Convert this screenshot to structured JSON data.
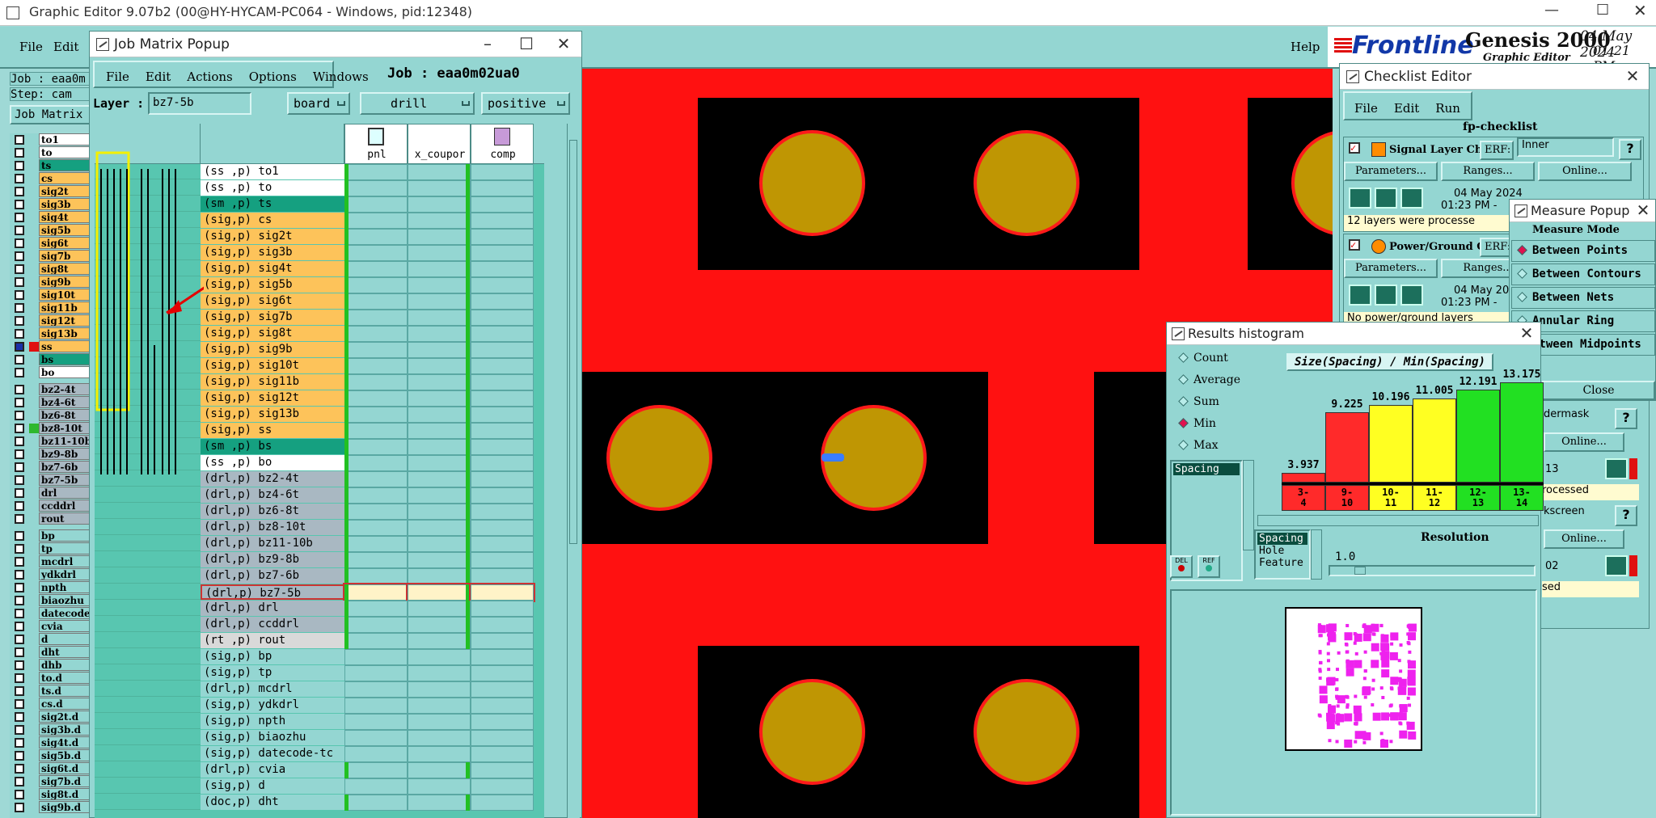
{
  "app": {
    "title": "Graphic Editor 9.07b2 (00@HY-HYCAM-PC064 - Windows, pid:12348)",
    "menu": [
      "File",
      "Edit"
    ],
    "help": "Help",
    "job_label": "Job : eaa0m",
    "step_label": "Step: cam",
    "job_matrix_btn": "Job Matrix"
  },
  "brand": {
    "logo": "Frontline",
    "product": "Genesis 2000",
    "subtitle": "Graphic Editor",
    "date": "04 May 2024",
    "time": "01:21 PM"
  },
  "left_layers": [
    "to1",
    "to",
    "ts",
    "cs",
    "sig2t",
    "sig3b",
    "sig4t",
    "sig5b",
    "sig6t",
    "sig7b",
    "sig8t",
    "sig9b",
    "sig10t",
    "sig11b",
    "sig12t",
    "sig13b",
    "ss",
    "bs",
    "bo",
    "bz2-4t",
    "bz4-6t",
    "bz6-8t",
    "bz8-10t",
    "bz11-10b",
    "bz9-8b",
    "bz7-6b",
    "bz7-5b",
    "drl",
    "ccddrl",
    "rout",
    "bp",
    "tp",
    "mcdrl",
    "ydkdrl",
    "npth",
    "biaozhu",
    "datecode",
    "cvia",
    "d",
    "dht",
    "dhb",
    "to.d",
    "ts.d",
    "cs.d",
    "sig2t.d",
    "sig3b.d",
    "sig4t.d",
    "sig5b.d",
    "sig6t.d",
    "sig7b.d",
    "sig8t.d",
    "sig9b.d"
  ],
  "job_matrix": {
    "title": "Job Matrix Popup",
    "menu": [
      "File",
      "Edit",
      "Actions",
      "Options",
      "Windows"
    ],
    "job": "Job : eaa0m02ua0",
    "layer_label": "Layer :",
    "layer_value": "bz7-5b",
    "ctx": "board",
    "type": "drill",
    "polarity": "positive",
    "steps": [
      "pnl",
      "x_coupor",
      "comp"
    ],
    "rows": [
      {
        "n": "(ss ,p) to1",
        "c": "#ffffff"
      },
      {
        "n": "(ss ,p) to",
        "c": "#ffffff"
      },
      {
        "n": "(sm ,p) ts",
        "c": "#15a080"
      },
      {
        "n": "(sig,p) cs",
        "c": "#fdc35a"
      },
      {
        "n": "(sig,p) sig2t",
        "c": "#fdc35a"
      },
      {
        "n": "(sig,p) sig3b",
        "c": "#fdc35a"
      },
      {
        "n": "(sig,p) sig4t",
        "c": "#fdc35a"
      },
      {
        "n": "(sig,p) sig5b",
        "c": "#fdc35a"
      },
      {
        "n": "(sig,p) sig6t",
        "c": "#fdc35a"
      },
      {
        "n": "(sig,p) sig7b",
        "c": "#fdc35a"
      },
      {
        "n": "(sig,p) sig8t",
        "c": "#fdc35a"
      },
      {
        "n": "(sig,p) sig9b",
        "c": "#fdc35a"
      },
      {
        "n": "(sig,p) sig10t",
        "c": "#fdc35a"
      },
      {
        "n": "(sig,p) sig11b",
        "c": "#fdc35a"
      },
      {
        "n": "(sig,p) sig12t",
        "c": "#fdc35a"
      },
      {
        "n": "(sig,p) sig13b",
        "c": "#fdc35a"
      },
      {
        "n": "(sig,p) ss",
        "c": "#fdc35a"
      },
      {
        "n": "(sm ,p) bs",
        "c": "#15a080"
      },
      {
        "n": "(ss ,p) bo",
        "c": "#ffffff"
      },
      {
        "n": "(drl,p) bz2-4t",
        "c": "#a9b8c2"
      },
      {
        "n": "(drl,p) bz4-6t",
        "c": "#a9b8c2"
      },
      {
        "n": "(drl,p) bz6-8t",
        "c": "#a9b8c2"
      },
      {
        "n": "(drl,p) bz8-10t",
        "c": "#a9b8c2"
      },
      {
        "n": "(drl,p) bz11-10b",
        "c": "#a9b8c2"
      },
      {
        "n": "(drl,p) bz9-8b",
        "c": "#a9b8c2"
      },
      {
        "n": "(drl,p) bz7-6b",
        "c": "#a9b8c2"
      },
      {
        "n": "(drl,p) bz7-5b",
        "c": "#a9b8c2"
      },
      {
        "n": "(drl,p) drl",
        "c": "#a9b8c2"
      },
      {
        "n": "(drl,p) ccddrl",
        "c": "#a9b8c2"
      },
      {
        "n": "(rt ,p) rout",
        "c": "#d9d9d9"
      },
      {
        "n": "(sig,p) bp",
        "c": "#94d6d2"
      },
      {
        "n": "(sig,p) tp",
        "c": "#94d6d2"
      },
      {
        "n": "(drl,p) mcdrl",
        "c": "#94d6d2"
      },
      {
        "n": "(sig,p) ydkdrl",
        "c": "#94d6d2"
      },
      {
        "n": "(sig,p) npth",
        "c": "#94d6d2"
      },
      {
        "n": "(sig,p) biaozhu",
        "c": "#94d6d2"
      },
      {
        "n": "(sig,p) datecode-tc",
        "c": "#94d6d2"
      },
      {
        "n": "(drl,p) cvia",
        "c": "#94d6d2"
      },
      {
        "n": "(sig,p) d",
        "c": "#94d6d2"
      },
      {
        "n": "(doc,p) dht",
        "c": "#94d6d2"
      }
    ]
  },
  "checklist": {
    "title": "Checklist Editor",
    "menu": [
      "File",
      "Edit",
      "Run"
    ],
    "name": "fp-checklist",
    "action1": "Signal Layer Ch",
    "erf": "ERF:",
    "erf_val1": "Inner",
    "params": "Parameters...",
    "ranges": "Ranges...",
    "online": "Online...",
    "date": "04 May 2024",
    "time": "01:23 PM -",
    "status1": "12 layers were processe",
    "action2": "Power/Ground C",
    "status2": "No power/ground layers",
    "frag1": "dermask",
    "frag2": "13",
    "frag3": "rocessed",
    "frag4": "kscreen",
    "frag5": "02",
    "frag6": "sed",
    "help": "?"
  },
  "measure": {
    "title": "Measure Popup",
    "mode": "Measure Mode",
    "options": [
      "Between Points",
      "Between Contours",
      "Between Nets",
      "Annular Ring",
      "etween Midpoints"
    ],
    "close": "Close"
  },
  "histogram": {
    "title": "Results histogram",
    "options": [
      "Count",
      "Average",
      "Sum",
      "Min",
      "Max"
    ],
    "selected": "Min",
    "heading": "Size(Spacing) / Min(Spacing)",
    "list_item": "Spacing",
    "del": "DEL",
    "ref": "REF",
    "types": [
      "Spacing",
      "Hole",
      "Feature"
    ],
    "resolution_label": "Resolution",
    "resolution": "1.0"
  },
  "chart_data": {
    "type": "bar",
    "title": "Size(Spacing) / Min(Spacing)",
    "categories": [
      "3-4",
      "9-10",
      "10-11",
      "11-12",
      "12-13",
      "13-14"
    ],
    "values": [
      3.937,
      9.225,
      10.196,
      11.005,
      12.191,
      13.175
    ],
    "colors": [
      "#ff2a2a",
      "#ff2a2a",
      "#ffff22",
      "#ffff22",
      "#22e022",
      "#22e022"
    ]
  }
}
